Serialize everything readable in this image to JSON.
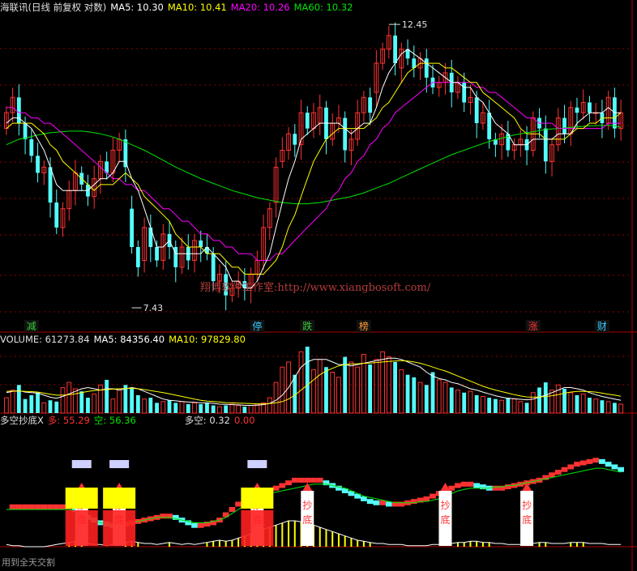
{
  "main_header": {
    "stock_name": "海联讯(日线 前复权 对数)",
    "ma5": "MA5: 10.30",
    "ma10": "MA10: 10.41",
    "ma20": "MA20: 10.26",
    "ma60": "MA60: 10.32"
  },
  "volume_header": {
    "volume": "VOLUME: 61273.84",
    "ma5": "MA5: 84356.40",
    "ma10": "MA10: 97829.80"
  },
  "indicator_header": {
    "name": "多空抄底X",
    "duo": "多: 55.29",
    "kong": "空: 56.36",
    "duokong": "多空: 0.32",
    "extra": "0.00"
  },
  "annotations": {
    "high_label": "12.45",
    "low_label": "7.43",
    "watermark": "翔博软件工作室:http://www.xiangbosoft.com/",
    "bottom_left": "用到全天交割",
    "signal_char_1": "抄",
    "signal_char_2": "底"
  },
  "event_markers": [
    {
      "index": 4,
      "text": "减",
      "color": "#33cc33"
    },
    {
      "index": 40,
      "text": "停",
      "color": "#33ccff"
    },
    {
      "index": 48,
      "text": "跌",
      "color": "#33cc33"
    },
    {
      "index": 57,
      "text": "榜",
      "color": "#ff9933"
    },
    {
      "index": 84,
      "text": "涨",
      "color": "#ff3333"
    },
    {
      "index": 95,
      "text": "财",
      "color": "#33ccff"
    }
  ],
  "colors": {
    "up": "#ff3232",
    "down": "#54fcfc",
    "ma5": "#ffffff",
    "ma10": "#ffff00",
    "ma20": "#ff00ff",
    "ma60": "#00e600",
    "grid": "#8b0000",
    "axis": "#b00000"
  },
  "chart_data": {
    "type": "candlestick",
    "title": "海联讯(日线 前复权 对数)",
    "price_range": [
      7.3,
      12.6
    ],
    "high": 12.45,
    "low": 7.43,
    "x": [
      0,
      1,
      2,
      3,
      4,
      5,
      6,
      7,
      8,
      9,
      10,
      11,
      12,
      13,
      14,
      15,
      16,
      17,
      18,
      19,
      20,
      21,
      22,
      23,
      24,
      25,
      26,
      27,
      28,
      29,
      30,
      31,
      32,
      33,
      34,
      35,
      36,
      37,
      38,
      39,
      40,
      41,
      42,
      43,
      44,
      45,
      46,
      47,
      48,
      49,
      50,
      51,
      52,
      53,
      54,
      55,
      56,
      57,
      58,
      59,
      60,
      61,
      62,
      63,
      64,
      65,
      66,
      67,
      68,
      69,
      70,
      71,
      72,
      73,
      74,
      75,
      76,
      77,
      78,
      79,
      80,
      81,
      82,
      83,
      84,
      85,
      86,
      87,
      88,
      89,
      90,
      91,
      92,
      93,
      94,
      95,
      96,
      97,
      98
    ],
    "close": [
      10.6,
      10.9,
      10.4,
      10.1,
      9.8,
      9.5,
      9.6,
      9.0,
      8.6,
      8.9,
      9.2,
      9.5,
      9.3,
      9.1,
      9.4,
      9.7,
      9.5,
      9.9,
      10.1,
      9.6,
      8.3,
      8.0,
      8.6,
      8.3,
      8.1,
      8.5,
      8.3,
      8.0,
      8.3,
      8.1,
      8.4,
      8.3,
      8.2,
      7.8,
      7.9,
      7.6,
      7.7,
      7.8,
      7.7,
      7.9,
      8.1,
      8.6,
      8.9,
      9.6,
      9.9,
      10.2,
      10.0,
      10.6,
      10.3,
      10.6,
      10.7,
      10.1,
      10.4,
      10.5,
      9.9,
      10.1,
      10.6,
      10.9,
      10.6,
      11.6,
      11.9,
      12.2,
      11.6,
      11.9,
      11.7,
      11.5,
      11.7,
      11.3,
      11.1,
      11.2,
      11.4,
      11.0,
      11.2,
      10.8,
      10.9,
      10.4,
      10.6,
      10.1,
      10.0,
      10.2,
      9.9,
      10.0,
      10.1,
      9.9,
      10.5,
      10.3,
      9.7,
      10.0,
      10.5,
      10.2,
      10.7,
      10.6,
      10.8,
      10.6,
      10.6,
      10.4,
      10.9,
      10.3,
      10.6
    ],
    "open": [
      10.3,
      10.6,
      10.9,
      10.4,
      10.1,
      9.8,
      9.5,
      9.6,
      9.0,
      8.6,
      8.9,
      9.2,
      9.5,
      9.3,
      9.1,
      9.4,
      9.7,
      9.5,
      9.9,
      10.1,
      8.9,
      8.3,
      8.1,
      8.6,
      8.3,
      8.1,
      8.5,
      8.3,
      8.0,
      8.3,
      8.1,
      8.4,
      8.3,
      8.2,
      7.8,
      7.9,
      7.6,
      7.7,
      7.8,
      7.7,
      7.9,
      8.1,
      8.6,
      9.0,
      9.7,
      9.9,
      10.2,
      10.0,
      10.6,
      10.3,
      10.4,
      10.7,
      10.1,
      10.4,
      10.5,
      9.9,
      10.1,
      10.6,
      10.9,
      11.0,
      11.6,
      11.9,
      12.2,
      11.5,
      11.9,
      11.7,
      11.5,
      11.7,
      11.3,
      11.1,
      11.2,
      11.4,
      11.0,
      11.2,
      10.8,
      10.9,
      10.4,
      10.6,
      10.1,
      10.0,
      10.2,
      9.9,
      10.0,
      10.1,
      9.9,
      10.5,
      10.3,
      9.7,
      10.0,
      10.5,
      10.2,
      10.7,
      10.6,
      10.8,
      10.6,
      10.6,
      10.4,
      10.9,
      10.3
    ],
    "ma5": [
      10.4,
      10.5,
      10.5,
      10.4,
      10.3,
      10.1,
      9.9,
      9.6,
      9.3,
      9.2,
      9.2,
      9.2,
      9.2,
      9.2,
      9.3,
      9.4,
      9.4,
      9.5,
      9.7,
      9.7,
      9.4,
      9.2,
      8.9,
      8.6,
      8.3,
      8.3,
      8.4,
      8.2,
      8.2,
      8.2,
      8.2,
      8.2,
      8.3,
      8.2,
      8.1,
      8.0,
      7.8,
      7.8,
      7.7,
      7.7,
      7.8,
      8.0,
      8.2,
      8.6,
      9.0,
      9.4,
      9.7,
      10.1,
      10.2,
      10.3,
      10.4,
      10.4,
      10.4,
      10.4,
      10.3,
      10.2,
      10.3,
      10.4,
      10.4,
      10.7,
      11.1,
      11.4,
      11.6,
      11.8,
      11.9,
      11.8,
      11.7,
      11.6,
      11.5,
      11.4,
      11.3,
      11.2,
      11.2,
      11.1,
      11.1,
      10.9,
      10.8,
      10.6,
      10.4,
      10.3,
      10.2,
      10.0,
      10.0,
      10.0,
      10.1,
      10.1,
      10.1,
      10.1,
      10.2,
      10.2,
      10.2,
      10.4,
      10.5,
      10.6,
      10.6,
      10.6,
      10.7,
      10.6,
      10.6
    ],
    "ma10": [
      10.3,
      10.4,
      10.4,
      10.4,
      10.4,
      10.3,
      10.2,
      10.0,
      9.9,
      9.7,
      9.6,
      9.5,
      9.4,
      9.3,
      9.2,
      9.3,
      9.3,
      9.3,
      9.4,
      9.5,
      9.4,
      9.3,
      9.1,
      9.0,
      8.9,
      8.8,
      8.7,
      8.5,
      8.4,
      8.3,
      8.3,
      8.3,
      8.2,
      8.2,
      8.2,
      8.1,
      8.0,
      8.0,
      7.9,
      7.9,
      7.9,
      7.9,
      8.0,
      8.1,
      8.3,
      8.6,
      8.8,
      9.1,
      9.4,
      9.7,
      9.9,
      10.1,
      10.2,
      10.3,
      10.3,
      10.3,
      10.3,
      10.3,
      10.4,
      10.5,
      10.7,
      10.8,
      11.0,
      11.2,
      11.4,
      11.5,
      11.6,
      11.6,
      11.6,
      11.6,
      11.5,
      11.5,
      11.4,
      11.3,
      11.2,
      11.2,
      11.0,
      10.9,
      10.8,
      10.7,
      10.6,
      10.5,
      10.3,
      10.2,
      10.2,
      10.2,
      10.1,
      10.1,
      10.1,
      10.1,
      10.2,
      10.3,
      10.3,
      10.4,
      10.4,
      10.5,
      10.5,
      10.5,
      10.6
    ],
    "ma20": [
      10.7,
      10.7,
      10.6,
      10.6,
      10.5,
      10.5,
      10.4,
      10.4,
      10.3,
      10.2,
      10.1,
      10.0,
      9.9,
      9.8,
      9.7,
      9.6,
      9.5,
      9.4,
      9.4,
      9.3,
      9.3,
      9.2,
      9.2,
      9.1,
      9.0,
      8.9,
      8.9,
      8.8,
      8.7,
      8.7,
      8.6,
      8.5,
      8.5,
      8.4,
      8.4,
      8.3,
      8.3,
      8.2,
      8.2,
      8.2,
      8.1,
      8.1,
      8.1,
      8.2,
      8.2,
      8.3,
      8.4,
      8.5,
      8.6,
      8.7,
      8.8,
      8.9,
      9.1,
      9.2,
      9.4,
      9.5,
      9.7,
      9.8,
      10.0,
      10.1,
      10.3,
      10.4,
      10.6,
      10.7,
      10.8,
      10.9,
      11.0,
      11.1,
      11.2,
      11.2,
      11.2,
      11.2,
      11.2,
      11.2,
      11.2,
      11.1,
      11.1,
      11.0,
      11.0,
      10.9,
      10.8,
      10.7,
      10.6,
      10.5,
      10.5,
      10.4,
      10.4,
      10.4,
      10.3,
      10.3,
      10.3,
      10.3,
      10.3,
      10.3,
      10.3,
      10.3,
      10.4,
      10.4,
      10.4
    ],
    "ma60": [
      10.0,
      10.05,
      10.1,
      10.12,
      10.15,
      10.18,
      10.2,
      10.22,
      10.23,
      10.24,
      10.25,
      10.25,
      10.25,
      10.24,
      10.22,
      10.2,
      10.17,
      10.14,
      10.1,
      10.05,
      10.0,
      9.95,
      9.9,
      9.84,
      9.78,
      9.72,
      9.66,
      9.6,
      9.55,
      9.5,
      9.45,
      9.4,
      9.36,
      9.32,
      9.28,
      9.24,
      9.2,
      9.17,
      9.14,
      9.11,
      9.08,
      9.06,
      9.04,
      9.02,
      9.0,
      8.99,
      8.98,
      8.98,
      8.98,
      8.99,
      9.0,
      9.02,
      9.04,
      9.06,
      9.08,
      9.1,
      9.13,
      9.16,
      9.2,
      9.24,
      9.28,
      9.32,
      9.37,
      9.42,
      9.47,
      9.52,
      9.57,
      9.62,
      9.67,
      9.72,
      9.77,
      9.82,
      9.86,
      9.9,
      9.94,
      9.98,
      10.02,
      10.06,
      10.09,
      10.12,
      10.15,
      10.18,
      10.2,
      10.22,
      10.24,
      10.26,
      10.28,
      10.29,
      10.3,
      10.31,
      10.32,
      10.33,
      10.34,
      10.35,
      10.35,
      10.36,
      10.36,
      10.35,
      10.32
    ],
    "volume": [
      60,
      90,
      110,
      55,
      70,
      80,
      40,
      50,
      45,
      100,
      120,
      95,
      85,
      60,
      75,
      110,
      130,
      55,
      95,
      110,
      100,
      70,
      55,
      60,
      40,
      45,
      50,
      40,
      45,
      35,
      40,
      35,
      40,
      30,
      25,
      30,
      35,
      30,
      25,
      30,
      35,
      40,
      60,
      120,
      180,
      200,
      150,
      240,
      260,
      170,
      210,
      180,
      160,
      140,
      220,
      200,
      180,
      230,
      190,
      210,
      240,
      220,
      200,
      170,
      150,
      140,
      120,
      110,
      160,
      130,
      120,
      100,
      90,
      80,
      85,
      70,
      65,
      60,
      55,
      50,
      60,
      55,
      45,
      40,
      80,
      100,
      120,
      90,
      110,
      95,
      80,
      70,
      75,
      60,
      55,
      50,
      45,
      40,
      35
    ],
    "vol_ma5": [
      80,
      85,
      88,
      82,
      80,
      78,
      70,
      62,
      58,
      65,
      75,
      85,
      95,
      100,
      95,
      90,
      95,
      95,
      90,
      95,
      100,
      95,
      85,
      75,
      65,
      55,
      50,
      48,
      45,
      43,
      42,
      40,
      40,
      38,
      35,
      34,
      33,
      32,
      30,
      30,
      31,
      33,
      38,
      50,
      70,
      100,
      140,
      180,
      200,
      210,
      210,
      210,
      200,
      190,
      190,
      185,
      190,
      195,
      200,
      205,
      210,
      215,
      215,
      210,
      200,
      190,
      180,
      160,
      145,
      135,
      130,
      120,
      115,
      105,
      95,
      90,
      82,
      75,
      68,
      62,
      58,
      56,
      54,
      52,
      55,
      62,
      70,
      80,
      90,
      100,
      100,
      95,
      90,
      80,
      72,
      65,
      60,
      55,
      50
    ],
    "vol_ma10": [
      85,
      86,
      86,
      85,
      84,
      82,
      78,
      74,
      70,
      70,
      72,
      75,
      80,
      85,
      88,
      90,
      92,
      94,
      95,
      96,
      97,
      95,
      92,
      88,
      84,
      80,
      75,
      70,
      65,
      60,
      55,
      50,
      47,
      45,
      43,
      41,
      40,
      39,
      38,
      37,
      36,
      36,
      37,
      40,
      45,
      55,
      70,
      90,
      110,
      130,
      150,
      165,
      175,
      185,
      190,
      192,
      193,
      195,
      196,
      198,
      200,
      202,
      204,
      205,
      204,
      200,
      195,
      188,
      180,
      172,
      165,
      155,
      145,
      135,
      125,
      115,
      105,
      97,
      90,
      84,
      78,
      72,
      67,
      63,
      62,
      63,
      65,
      68,
      72,
      78,
      82,
      85,
      85,
      84,
      82,
      78,
      74,
      70,
      66
    ],
    "duo": [
      60,
      60,
      60,
      60,
      60,
      60,
      60,
      60,
      60,
      60,
      60,
      58,
      56,
      52,
      50,
      48,
      47,
      46,
      46,
      47,
      48,
      49,
      50,
      51,
      52,
      53,
      53,
      52,
      50,
      48,
      46,
      46,
      47,
      48,
      50,
      54,
      58,
      62,
      64,
      66,
      68,
      70,
      72,
      74,
      76,
      78,
      80,
      80,
      80,
      80,
      80,
      78,
      76,
      74,
      72,
      70,
      68,
      66,
      64,
      63,
      63,
      62,
      62,
      62,
      63,
      64,
      65,
      66,
      68,
      70,
      72,
      74,
      76,
      77,
      77,
      76,
      75,
      74,
      74,
      74,
      75,
      76,
      77,
      78,
      79,
      80,
      82,
      84,
      86,
      88,
      90,
      92,
      93,
      94,
      95,
      94,
      92,
      90,
      88
    ],
    "kong": [
      58,
      58,
      58,
      58,
      58,
      58,
      58,
      58,
      58,
      58,
      58,
      57,
      55,
      53,
      50,
      48,
      47,
      47,
      47,
      47,
      48,
      49,
      50,
      51,
      52,
      52,
      52,
      51,
      50,
      49,
      48,
      48,
      48,
      49,
      50,
      52,
      55,
      58,
      61,
      64,
      66,
      68,
      70,
      71,
      72,
      73,
      74,
      75,
      76,
      77,
      77,
      77,
      76,
      75,
      74,
      72,
      70,
      68,
      67,
      66,
      65,
      64,
      63,
      63,
      63,
      63,
      64,
      64,
      65,
      66,
      68,
      70,
      72,
      73,
      74,
      74,
      74,
      74,
      75,
      75,
      76,
      76,
      77,
      78,
      79,
      80,
      81,
      82,
      83,
      84,
      85,
      86,
      87,
      88,
      89,
      89,
      88,
      87,
      86
    ],
    "duokong": [
      2,
      1,
      1,
      0,
      0,
      0,
      0,
      1,
      2,
      3,
      4,
      5,
      4,
      3,
      2,
      2,
      1,
      2,
      3,
      4,
      5,
      4,
      3,
      3,
      2,
      3,
      4,
      3,
      2,
      3,
      2,
      3,
      4,
      5,
      6,
      5,
      6,
      8,
      10,
      12,
      14,
      16,
      18,
      20,
      22,
      24,
      24,
      23,
      22,
      20,
      18,
      16,
      14,
      12,
      10,
      8,
      6,
      5,
      4,
      3,
      3,
      2,
      2,
      2,
      1,
      1,
      1,
      1,
      2,
      2,
      3,
      3,
      4,
      4,
      5,
      5,
      4,
      4,
      3,
      3,
      2,
      2,
      2,
      3,
      3,
      4,
      4,
      3,
      3,
      3,
      4,
      4,
      4,
      3,
      3,
      3,
      2,
      2,
      2
    ],
    "buy_signal_indices": [
      12,
      18,
      40,
      48,
      70,
      83
    ]
  }
}
